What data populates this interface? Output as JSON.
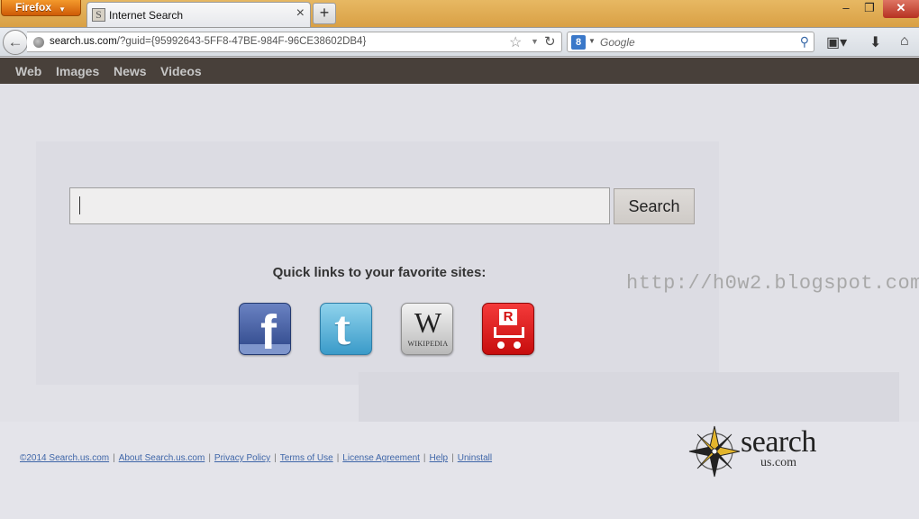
{
  "browser": {
    "app_button": "Firefox",
    "tab_title": "Internet Search",
    "tab_favicon": "S",
    "url_host": "search.us.com",
    "url_path": "/?guid={95992643-5FF8-47BE-984F-96CE38602DB4}",
    "search_placeholder": "Google",
    "search_engine_letter": "8"
  },
  "site_nav": {
    "items": [
      {
        "label": "Web"
      },
      {
        "label": "Images"
      },
      {
        "label": "News"
      },
      {
        "label": "Videos"
      }
    ]
  },
  "main": {
    "search_button": "Search",
    "search_value": "",
    "quick_links_title": "Quick links to your favorite sites:",
    "quick_links": [
      {
        "name": "Facebook",
        "glyph": "f",
        "icon": "facebook-icon"
      },
      {
        "name": "Twitter",
        "glyph": "t",
        "icon": "twitter-icon"
      },
      {
        "name": "Wikipedia",
        "glyph": "W",
        "caption": "WIKIPEDIA",
        "icon": "wikipedia-icon"
      },
      {
        "name": "Shopping",
        "glyph": "R",
        "icon": "shopping-cart-icon"
      }
    ],
    "watermark": "http://h0w2.blogspot.com"
  },
  "footer": {
    "links": [
      {
        "label": "©2014 Search.us.com"
      },
      {
        "label": "About Search.us.com"
      },
      {
        "label": "Privacy Policy"
      },
      {
        "label": "Terms of Use"
      },
      {
        "label": "License Agreement"
      },
      {
        "label": "Help"
      },
      {
        "label": "Uninstall"
      }
    ],
    "separator": "|"
  },
  "logo": {
    "word": "search",
    "sub": "us.com"
  },
  "colors": {
    "site_nav_bg": "#48403a",
    "firefox_orange": "#e66000",
    "link_blue": "#3f66a8"
  }
}
